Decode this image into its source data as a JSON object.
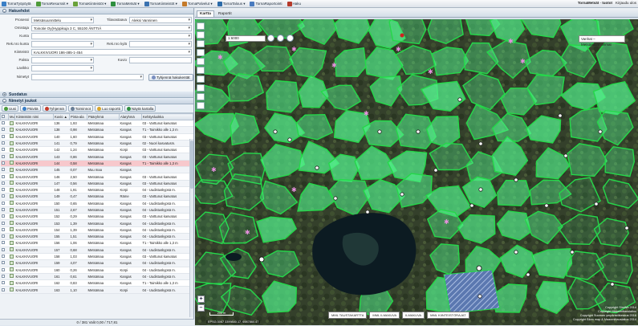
{
  "topbar": {
    "menus": [
      {
        "label": "TornaTyöpöytä",
        "color": "#3a7fc6",
        "icon": "desktop-icon"
      },
      {
        "label": "TornaResurssit ▾",
        "color": "#4e9a3a",
        "icon": "resources-icon"
      },
      {
        "label": "TornaKiinteistöt ▾",
        "color": "#6aa23a",
        "icon": "property-icon"
      },
      {
        "label": "TornaMetsät ▾",
        "color": "#2f8f3f",
        "icon": "forest-icon"
      },
      {
        "label": "TornaKiinteistöt ▾",
        "color": "#3b72b0",
        "icon": "buildings-icon"
      },
      {
        "label": "TornaPalvelut ▾",
        "color": "#c47a2a",
        "icon": "services-icon"
      },
      {
        "label": "TornaTalous ▾",
        "color": "#2c6aa8",
        "icon": "economy-icon"
      },
      {
        "label": "TornaRaportointi",
        "color": "#4a7bbf",
        "icon": "report-icon"
      },
      {
        "label": "Haku",
        "color": "#b53a2a",
        "icon": "search-icon"
      }
    ],
    "user": "TornaMetsät · tuotot",
    "signout": "Kirjaudu ulos"
  },
  "hakuehdot": {
    "title": "Hakuehdot",
    "prosessi_label": "Prosessi",
    "prosessi_value": "Metsäsuunnittelu",
    "tilavastaava_label": "Tilavastaava",
    "tilavastaava_value": "Aleksi Vanninen",
    "omistaja_label": "Omistaja",
    "omistaja_value": "Toinotie Oy(Hyppikuja 3 C, 55100 ÄNTTIÄ",
    "kunta_label": "Kunta",
    "reknro_kunta_label": "Rek.nro kunta",
    "reknro_kyla_label": "Rek.nro kylä",
    "kiinteisto_label": "Kiinteistö",
    "kiinteisto_value": "KALKKIVUORI 186-485-1-454",
    "palsta_label": "Palsta",
    "kuvio_label": "Kuvio",
    "lavikko_label": "Lavikko",
    "nimetyt_label": "Nimetyt",
    "search_button": "Tyhjennä hakukentät"
  },
  "sivutilat": {
    "title": "Suodatus"
  },
  "nimetyt": {
    "title": "Nimetyt joukot"
  },
  "toolbar": {
    "uusi": "Uusi",
    "paivita": "Päivitä",
    "tyhjenna": "Tyhjennä",
    "toiminnot": "Toiminnot",
    "luo_raportti": "Luo raportti",
    "nayta_kartalla": "Näytä kartalla"
  },
  "table": {
    "headers": [
      "Muo",
      "Kiinteistön nimi",
      "Kuvio ▲",
      "Pinta-ala",
      "Pääryhmä",
      "Alaryhmä",
      "Kehitysluokka"
    ],
    "rows": [
      [
        "KALKKIVUORI",
        "136",
        "1,93",
        "Metsämaa",
        "Kangas",
        "03 - Varttunut kasvatus"
      ],
      [
        "KALKKIVUORI",
        "138",
        "0,98",
        "Metsämaa",
        "Kangas",
        "T1 - Taimikko alle 1,3 m"
      ],
      [
        "KALKKIVUORI",
        "140",
        "1,60",
        "Metsämaa",
        "Kangas",
        "03 - Varttunut kasvatus"
      ],
      [
        "KALKKIVUORI",
        "141",
        "0,79",
        "Metsämaa",
        "Kangas",
        "02 - Nuori kasvatusm."
      ],
      [
        "KALKKIVUORI",
        "142",
        "1,24",
        "Metsämaa",
        "Korpi",
        "03 - Varttunut kasvatus"
      ],
      [
        "KALKKIVUORI",
        "143",
        "0,86",
        "Metsämaa",
        "Kangas",
        "03 - Varttunut kasvatus"
      ],
      [
        "KALKKIVUORI",
        "144",
        "0,58",
        "Metsämaa",
        "Kangas",
        "T1 - Taimikko alle 1,3 m"
      ],
      [
        "KALKKIVUORI",
        "145",
        "0,07",
        "Muu maa",
        "Kangas",
        ""
      ],
      [
        "KALKKIVUORI",
        "146",
        "2,50",
        "Metsämaa",
        "Kangas",
        "03 - Varttunut kasvatus"
      ],
      [
        "KALKKIVUORI",
        "147",
        "0,56",
        "Metsämaa",
        "Kangas",
        "03 - Varttunut kasvatus"
      ],
      [
        "KALKKIVUORI",
        "148",
        "1,91",
        "Metsämaa",
        "Korpi",
        "04 - Uudistuskypsä m."
      ],
      [
        "KALKKIVUORI",
        "149",
        "0,47",
        "Metsämaa",
        "Räme",
        "03 - Varttunut kasvatus"
      ],
      [
        "KALKKIVUORI",
        "150",
        "0,65",
        "Metsämaa",
        "Kangas",
        "04 - Uudistuskypsä m."
      ],
      [
        "KALKKIVUORI",
        "151",
        "2,67",
        "Metsämaa",
        "Kangas",
        "04 - Uudistuskypsä m."
      ],
      [
        "KALKKIVUORI",
        "152",
        "0,29",
        "Metsämaa",
        "Kangas",
        "03 - Varttunut kasvatus"
      ],
      [
        "KALKKIVUORI",
        "153",
        "1,39",
        "Metsämaa",
        "Kangas",
        "04 - Uudistuskypsä m."
      ],
      [
        "KALKKIVUORI",
        "154",
        "1,39",
        "Metsämaa",
        "Kangas",
        "04 - Uudistuskypsä m."
      ],
      [
        "KALKKIVUORI",
        "155",
        "1,51",
        "Metsämaa",
        "Kangas",
        "04 - Uudistuskypsä m."
      ],
      [
        "KALKKIVUORI",
        "156",
        "1,06",
        "Metsämaa",
        "Kangas",
        "T1 - Taimikko alle 1,3 m"
      ],
      [
        "KALKKIVUORI",
        "157",
        "0,68",
        "Metsämaa",
        "Kangas",
        "04 - Uudistuskypsä m."
      ],
      [
        "KALKKIVUORI",
        "158",
        "1,03",
        "Metsämaa",
        "Kangas",
        "03 - Varttunut kasvatus"
      ],
      [
        "KALKKIVUORI",
        "159",
        "4,07",
        "Metsämaa",
        "Kangas",
        "04 - Uudistuskypsä m."
      ],
      [
        "KALKKIVUORI",
        "160",
        "0,26",
        "Metsämaa",
        "Korpi",
        "04 - Uudistuskypsä m."
      ],
      [
        "KALKKIVUORI",
        "161",
        "0,61",
        "Metsämaa",
        "Kangas",
        "04 - Uudistuskypsä m."
      ],
      [
        "KALKKIVUORI",
        "162",
        "0,83",
        "Metsämaa",
        "Kangas",
        "T1 - Taimikko alle 1,3 m"
      ],
      [
        "KALKKIVUORI",
        "163",
        "1,10",
        "Metsämaa",
        "Korpi",
        "04 - Uudistuskypsä m."
      ]
    ],
    "selected_index": 6
  },
  "footer": {
    "text": "0 / 381 Valit 0,00 / 717,81"
  },
  "map": {
    "tabs": [
      "Kartta",
      "Raportit"
    ],
    "scale": "1:6000",
    "layer": "Vanhat – Metsäsuunnitelmat",
    "bottom_buttons": [
      "MML TAUSTAKARTTA",
      "MML ILMAKUVA",
      "ILMAKUVA",
      "MML KIINTEISTÖRAJAT"
    ],
    "copyright_lines": [
      "Copyright SimWa 2014",
      "Copyright Maanmittauslaitos",
      "Copyright Suomen ympäristökeskus 2016",
      "Copyright Blom map & Maanmittauslaitos 2014"
    ],
    "coords": "EPSG:3067 3399840.17, 6987860.47",
    "scalebar": "200 m",
    "colors": {
      "parcel_fill": "#53f08c",
      "parcel_stroke": "#25d84a",
      "lake": "#0c1b22",
      "forest": "#33402a"
    }
  }
}
